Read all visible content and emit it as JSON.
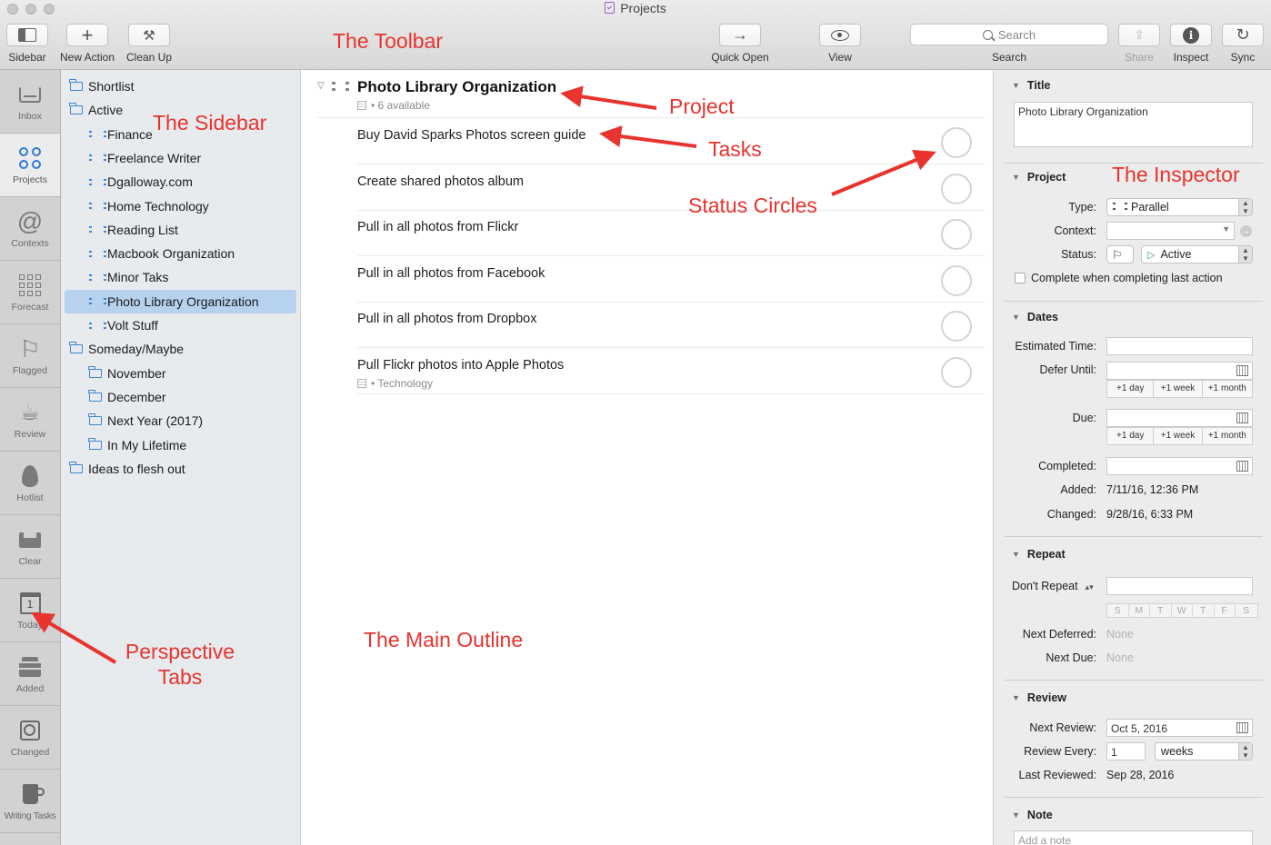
{
  "window": {
    "title": "Projects"
  },
  "toolbar": {
    "sidebar_label": "Sidebar",
    "new_action_label": "New Action",
    "clean_up_label": "Clean Up",
    "quick_open_label": "Quick Open",
    "view_label": "View",
    "search_placeholder": "Search",
    "search_label": "Search",
    "share_label": "Share",
    "inspect_label": "Inspect",
    "sync_label": "Sync"
  },
  "perspectives": [
    {
      "label": "Inbox",
      "icon": "inbox-icon"
    },
    {
      "label": "Projects",
      "icon": "projects-icon",
      "active": true
    },
    {
      "label": "Contexts",
      "icon": "at-sign-icon"
    },
    {
      "label": "Forecast",
      "icon": "grid-icon"
    },
    {
      "label": "Flagged",
      "icon": "flag-icon"
    },
    {
      "label": "Review",
      "icon": "coffee-cup-icon"
    },
    {
      "label": "Hotlist",
      "icon": "flame-icon"
    },
    {
      "label": "Clear",
      "icon": "tray-icon"
    },
    {
      "label": "Today",
      "icon": "calendar-icon",
      "day": "1"
    },
    {
      "label": "Added",
      "icon": "stack-icon"
    },
    {
      "label": "Changed",
      "icon": "no-entry-icon"
    },
    {
      "label": "Writing Tasks",
      "icon": "mug-icon"
    }
  ],
  "sidebar": {
    "items": [
      {
        "label": "Shortlist",
        "type": "folder",
        "indent": 0
      },
      {
        "label": "Active",
        "type": "folder-open",
        "indent": 0
      },
      {
        "label": "Finance",
        "type": "project",
        "indent": 1
      },
      {
        "label": "Freelance Writer",
        "type": "project",
        "indent": 1
      },
      {
        "label": "Dgalloway.com",
        "type": "project",
        "indent": 1
      },
      {
        "label": "Home Technology",
        "type": "project",
        "indent": 1
      },
      {
        "label": "Reading List",
        "type": "project",
        "indent": 1
      },
      {
        "label": "Macbook Organization",
        "type": "project",
        "indent": 1
      },
      {
        "label": "Minor Taks",
        "type": "project",
        "indent": 1
      },
      {
        "label": "Photo Library Organization",
        "type": "project",
        "indent": 1,
        "selected": true
      },
      {
        "label": "Volt Stuff",
        "type": "project",
        "indent": 1
      },
      {
        "label": "Someday/Maybe",
        "type": "folder-open",
        "indent": 0
      },
      {
        "label": "November",
        "type": "folder",
        "indent": 1
      },
      {
        "label": "December",
        "type": "folder",
        "indent": 1
      },
      {
        "label": "Next Year (2017)",
        "type": "folder",
        "indent": 1
      },
      {
        "label": "In My Lifetime",
        "type": "folder",
        "indent": 1
      },
      {
        "label": "Ideas to flesh out",
        "type": "folder",
        "indent": 0
      }
    ]
  },
  "outline": {
    "project_title": "Photo Library Organization",
    "project_sub": "• 6 available",
    "tasks": [
      {
        "title": "Buy David Sparks Photos screen guide",
        "sub": ""
      },
      {
        "title": "Create shared photos album",
        "sub": ""
      },
      {
        "title": "Pull in all photos from Flickr",
        "sub": ""
      },
      {
        "title": "Pull in all photos from Facebook",
        "sub": ""
      },
      {
        "title": "Pull in all photos from Dropbox",
        "sub": ""
      },
      {
        "title": "Pull Flickr photos into Apple Photos",
        "sub": "• Technology"
      }
    ]
  },
  "inspector": {
    "title_section": {
      "heading": "Title",
      "value": "Photo Library Organization"
    },
    "project_section": {
      "heading": "Project",
      "type_label": "Type:",
      "type_value": "Parallel",
      "context_label": "Context:",
      "context_value": "",
      "status_label": "Status:",
      "status_value": "Active",
      "complete_checkbox_label": "Complete when completing last action"
    },
    "dates_section": {
      "heading": "Dates",
      "estimated_label": "Estimated Time:",
      "defer_label": "Defer Until:",
      "due_label": "Due:",
      "completed_label": "Completed:",
      "added_label": "Added:",
      "added_value": "7/11/16, 12:36 PM",
      "changed_label": "Changed:",
      "changed_value": "9/28/16, 6:33 PM",
      "quick": [
        "+1 day",
        "+1 week",
        "+1 month"
      ]
    },
    "repeat_section": {
      "heading": "Repeat",
      "repeat_value": "Don't Repeat",
      "days": [
        "S",
        "M",
        "T",
        "W",
        "T",
        "F",
        "S"
      ],
      "next_deferred_label": "Next Deferred:",
      "next_deferred_value": "None",
      "next_due_label": "Next Due:",
      "next_due_value": "None"
    },
    "review_section": {
      "heading": "Review",
      "next_review_label": "Next Review:",
      "next_review_value": "Oct 5, 2016",
      "review_every_label": "Review Every:",
      "review_every_value": "1",
      "review_every_unit": "weeks",
      "last_reviewed_label": "Last Reviewed:",
      "last_reviewed_value": "Sep 28, 2016"
    },
    "note_section": {
      "heading": "Note",
      "placeholder": "Add a note"
    }
  },
  "annotations": {
    "toolbar": "The Toolbar",
    "sidebar": "The Sidebar",
    "project": "Project",
    "tasks": "Tasks",
    "status_circles": "Status Circles",
    "inspector": "The Inspector",
    "main_outline": "The Main Outline",
    "perspective_line1": "Perspective",
    "perspective_line2": "Tabs",
    "color": "#e8332e"
  }
}
